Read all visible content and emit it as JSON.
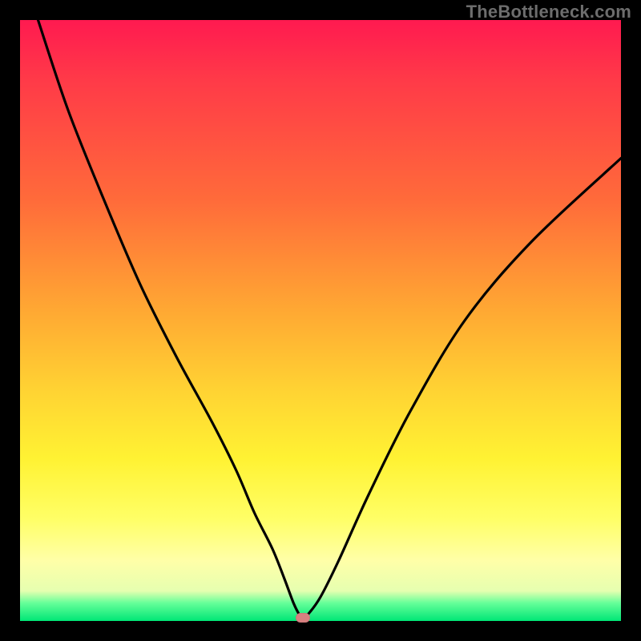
{
  "watermark": "TheBottleneck.com",
  "chart_data": {
    "type": "line",
    "title": "",
    "xlabel": "",
    "ylabel": "",
    "xlim": [
      0,
      100
    ],
    "ylim": [
      0,
      100
    ],
    "series": [
      {
        "name": "bottleneck-curve",
        "x": [
          3,
          8,
          14,
          20,
          26,
          32,
          36,
          39,
          42,
          44,
          45.5,
          46.5,
          47,
          48,
          50,
          53,
          58,
          65,
          74,
          85,
          100
        ],
        "y": [
          100,
          85,
          70,
          56,
          44,
          33,
          25,
          18,
          12,
          7,
          3,
          1,
          0.5,
          1.2,
          4,
          10,
          21,
          35,
          50,
          63,
          77
        ]
      }
    ],
    "marker": {
      "x": 47,
      "y": 0.5,
      "color": "#d88080"
    },
    "gradient_stops": [
      {
        "pct": 0,
        "color": "#ff1a50"
      },
      {
        "pct": 30,
        "color": "#ff6b3a"
      },
      {
        "pct": 62,
        "color": "#ffd433"
      },
      {
        "pct": 90,
        "color": "#ffffa8"
      },
      {
        "pct": 100,
        "color": "#00e676"
      }
    ]
  }
}
